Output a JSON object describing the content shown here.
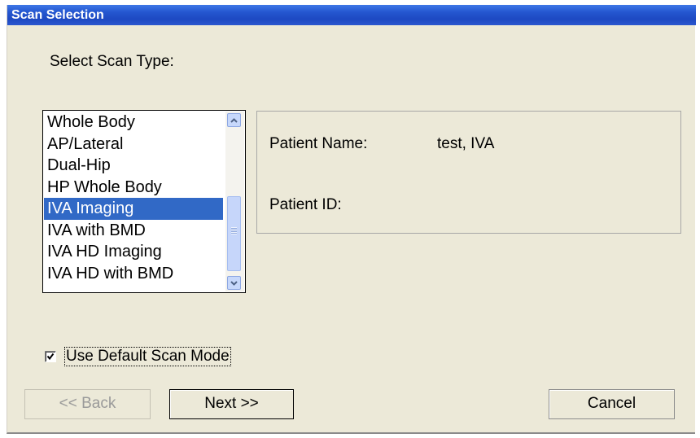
{
  "window": {
    "title": "Scan Selection"
  },
  "scan_type": {
    "label": "Select Scan Type:",
    "items": [
      {
        "label": "Whole Body"
      },
      {
        "label": "AP/Lateral"
      },
      {
        "label": "Dual-Hip"
      },
      {
        "label": "HP Whole Body"
      },
      {
        "label": "IVA Imaging"
      },
      {
        "label": "IVA with BMD"
      },
      {
        "label": "IVA HD Imaging"
      },
      {
        "label": "IVA HD with BMD"
      }
    ],
    "selected": "IVA Imaging",
    "scroll_icons": {
      "up": "chevron-up-icon",
      "down": "chevron-down-icon"
    }
  },
  "patient": {
    "name_label": "Patient Name:",
    "name_value": "test, IVA",
    "id_label": "Patient ID:",
    "id_value": ""
  },
  "options": {
    "default_mode_label": "Use Default Scan Mode",
    "default_mode_checked": true
  },
  "buttons": {
    "back": {
      "label": "<< Back",
      "enabled": false
    },
    "next": {
      "label": "Next >>",
      "enabled": true
    },
    "cancel": {
      "label": "Cancel",
      "enabled": true
    }
  },
  "colors": {
    "title_bar": "#2557d0",
    "selection": "#3169c6",
    "dialog_bg": "#ece9d8"
  }
}
